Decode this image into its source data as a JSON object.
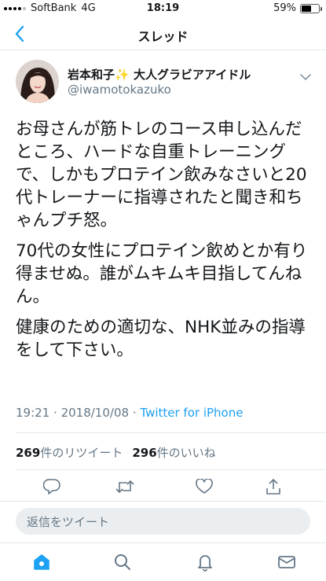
{
  "status_bar": {
    "carrier": "SoftBank",
    "network": "4G",
    "time": "18:19",
    "battery": "59%",
    "battery_level": 0.59
  },
  "nav": {
    "title": "スレッド",
    "back_icon": "chevron-left-icon"
  },
  "tweet": {
    "author_name": "岩本和子",
    "author_emoji": "✨",
    "author_suffix": "大人グラビアアイドル",
    "handle": "@iwamotokazuko",
    "paragraphs": [
      "お母さんが筋トレのコース申し込んだところ、ハードな自重トレーニングで、しかもプロテイン飲みなさいと20代トレーナーに指導されたと聞き和ちゃんプチ怒。",
      "70代の女性にプロテイン飲めとか有り得ませぬ。誰がムキムキ目指してんねん。",
      "健康のための適切な、NHK並みの指導をして下さい。"
    ],
    "time": "19:21",
    "separator": "·",
    "date": "2018/10/08",
    "source": "Twitter for iPhone",
    "retweet_count": "269",
    "retweet_label": "件のリツイート",
    "like_count": "296",
    "like_label": "件のいいね"
  },
  "reply": {
    "placeholder": "返信をツイート"
  },
  "colors": {
    "accent": "#1da1f2",
    "secondary_text": "#657786",
    "border": "#e1e8ed"
  },
  "icons": {
    "actions": [
      "reply-icon",
      "retweet-icon",
      "like-icon",
      "share-icon"
    ],
    "tabs": [
      "home-icon",
      "search-icon",
      "notifications-icon",
      "messages-icon"
    ]
  }
}
